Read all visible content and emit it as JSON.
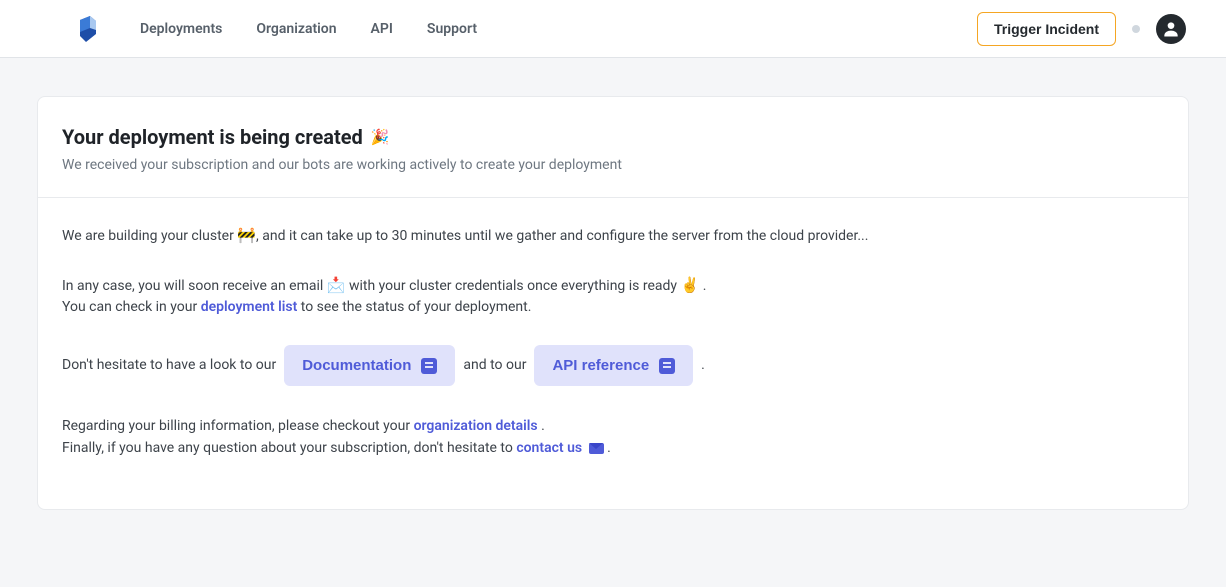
{
  "nav": {
    "items": [
      {
        "label": "Deployments"
      },
      {
        "label": "Organization"
      },
      {
        "label": "API"
      },
      {
        "label": "Support"
      }
    ]
  },
  "topbar": {
    "trigger_label": "Trigger Incident"
  },
  "header": {
    "title": "Your deployment is being created",
    "title_emoji": "🎉",
    "subtitle": "We received your subscription and our bots are working actively to create your deployment"
  },
  "body": {
    "p1_a": "We are building your cluster",
    "p1_emoji": "🚧",
    "p1_b": ", and it can take up to 30 minutes until we gather and configure the server from the cloud provider...",
    "p2_a": "In any case, you will soon receive an email",
    "p2_emoji1": "📩",
    "p2_b": "with your cluster credentials once everything is ready",
    "p2_emoji2": "✌️",
    "p2_c": ".",
    "p2_d": "You can check in your",
    "deployment_list_link": "deployment list",
    "p2_e": "to see the status of your deployment.",
    "p3_a": "Don't hesitate to have a look to our",
    "doc_btn": "Documentation",
    "p3_b": "and to our",
    "api_btn": "API reference",
    "p3_c": ".",
    "p4_a": "Regarding your billing information, please checkout your",
    "org_details_link": "organization details",
    "p4_b": ".",
    "p4_c": "Finally, if you have any question about your subscription, don't hesitate to",
    "contact_link": "contact us",
    "p4_d": "."
  }
}
